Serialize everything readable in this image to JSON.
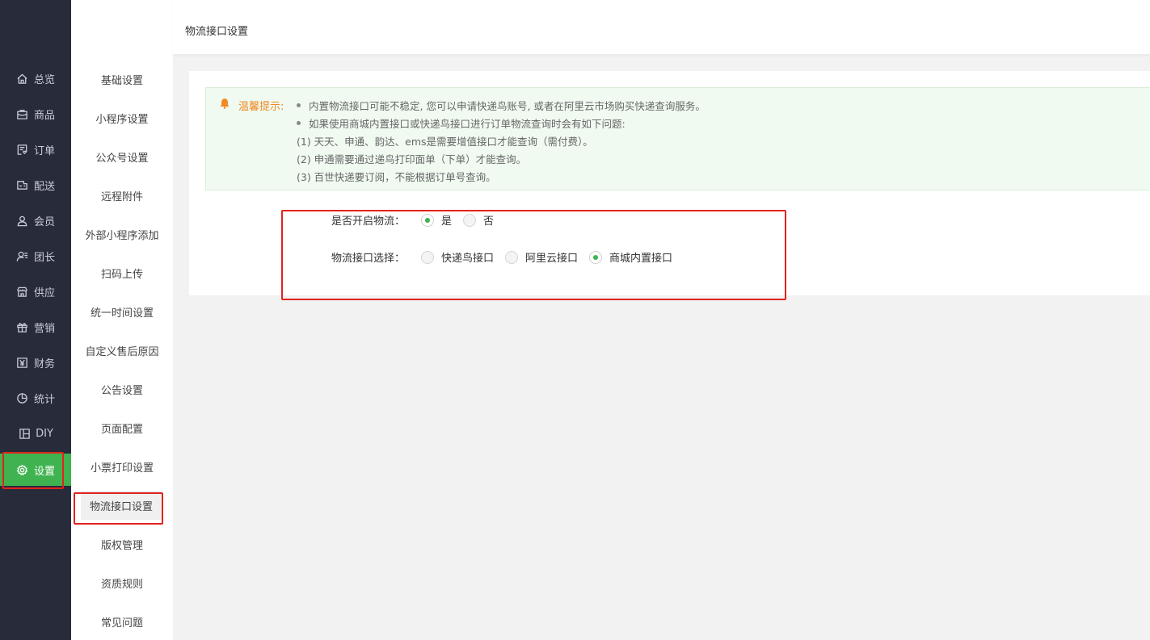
{
  "nav_primary": [
    {
      "label": "总览",
      "icon": "home-icon"
    },
    {
      "label": "商品",
      "icon": "goods-icon"
    },
    {
      "label": "订单",
      "icon": "order-icon"
    },
    {
      "label": "配送",
      "icon": "delivery-icon"
    },
    {
      "label": "会员",
      "icon": "member-icon"
    },
    {
      "label": "团长",
      "icon": "leader-icon"
    },
    {
      "label": "供应",
      "icon": "supply-icon"
    },
    {
      "label": "营销",
      "icon": "gift-icon"
    },
    {
      "label": "财务",
      "icon": "finance-icon"
    },
    {
      "label": "统计",
      "icon": "chart-icon"
    },
    {
      "label": "DIY",
      "icon": "layout-icon"
    },
    {
      "label": "设置",
      "icon": "gear-icon",
      "active": true
    }
  ],
  "nav_secondary": [
    {
      "label": "基础设置"
    },
    {
      "label": "小程序设置"
    },
    {
      "label": "公众号设置"
    },
    {
      "label": "远程附件"
    },
    {
      "label": "外部小程序添加"
    },
    {
      "label": "扫码上传"
    },
    {
      "label": "统一时间设置"
    },
    {
      "label": "自定义售后原因"
    },
    {
      "label": "公告设置"
    },
    {
      "label": "页面配置"
    },
    {
      "label": "小票打印设置"
    },
    {
      "label": "物流接口设置",
      "active": true
    },
    {
      "label": "版权管理"
    },
    {
      "label": "资质规则"
    },
    {
      "label": "常见问题"
    }
  ],
  "header": {
    "breadcrumb": "物流接口设置"
  },
  "alert": {
    "label": "温馨提示:",
    "bullets": [
      "内置物流接口可能不稳定, 您可以申请快递鸟账号, 或者在阿里云市场购买快递查询服务。",
      "如果使用商城内置接口或快递鸟接口进行订单物流查询时会有如下问题:"
    ],
    "notes": [
      "(1) 天天、申通、韵达、ems是需要增值接口才能查询（需付费）。",
      "(2) 申通需要通过递鸟打印面单（下单）才能查询。",
      "(3) 百世快递要订阅，不能根据订单号查询。"
    ]
  },
  "form": {
    "enable": {
      "label": "是否开启物流：",
      "options": [
        {
          "label": "是",
          "checked": true
        },
        {
          "label": "否",
          "checked": false
        }
      ]
    },
    "interface": {
      "label": "物流接口选择：",
      "options": [
        {
          "label": "快递鸟接口",
          "checked": false
        },
        {
          "label": "阿里云接口",
          "checked": false
        },
        {
          "label": "商城内置接口",
          "checked": true
        }
      ]
    }
  },
  "colors": {
    "accent": "#3fb34f",
    "sidebar": "#282b3a",
    "warning": "#f08a24",
    "annotation": "#e0231d"
  }
}
